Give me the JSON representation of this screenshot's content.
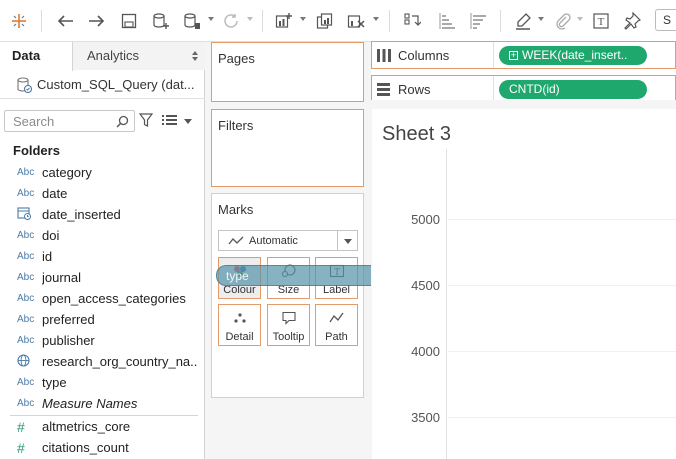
{
  "toolbar": {
    "buttons": [
      "tableau-logo-icon",
      "undo-icon",
      "redo-icon",
      "save-icon",
      "new-datasource-icon",
      "pause-updates-icon",
      "refresh-icon",
      "new-worksheet-icon",
      "duplicate-sheet-icon",
      "clear-sheet-icon",
      "swap-icon",
      "sort-ascending-icon",
      "sort-descending-icon",
      "highlight-icon",
      "group-icon",
      "label-icon",
      "pin-icon"
    ],
    "right_box_label": "S"
  },
  "left_pane": {
    "tabs": [
      {
        "label": "Data"
      },
      {
        "label": "Analytics"
      }
    ],
    "datasource": "Custom_SQL_Query (dat...",
    "search_placeholder": "Search",
    "folders_heading": "Folders",
    "dimensions": [
      {
        "type": "Abc",
        "name": "category"
      },
      {
        "type": "Abc",
        "name": "date"
      },
      {
        "type": "calendar",
        "name": "date_inserted"
      },
      {
        "type": "Abc",
        "name": "doi"
      },
      {
        "type": "Abc",
        "name": "id"
      },
      {
        "type": "Abc",
        "name": "journal"
      },
      {
        "type": "Abc",
        "name": "open_access_categories"
      },
      {
        "type": "Abc",
        "name": "preferred"
      },
      {
        "type": "Abc",
        "name": "publisher"
      },
      {
        "type": "globe",
        "name": "research_org_country_na..."
      },
      {
        "type": "Abc",
        "name": "type"
      },
      {
        "type": "Abc",
        "name": "Measure Names"
      }
    ],
    "measures": [
      {
        "type": "#",
        "name": "altmetrics_core"
      },
      {
        "type": "#",
        "name": "citations_count"
      }
    ]
  },
  "cards": {
    "pages_title": "Pages",
    "filters_title": "Filters",
    "marks_title": "Marks",
    "mark_type": "Automatic",
    "mark_buttons": [
      {
        "label": "Colour"
      },
      {
        "label": "Size"
      },
      {
        "label": "Label"
      },
      {
        "label": "Detail"
      },
      {
        "label": "Tooltip"
      },
      {
        "label": "Path"
      }
    ]
  },
  "drag_pill": {
    "label": "type"
  },
  "shelves": {
    "columns_label": "Columns",
    "columns_pill": "WEEK(date_insert..",
    "rows_label": "Rows",
    "rows_pill": "CNTD(id)"
  },
  "view": {
    "sheet_title": "Sheet 3",
    "y_ticks": [
      "5000",
      "4500",
      "4000",
      "3500"
    ]
  },
  "colors": {
    "accent_orange": "#e39b6a",
    "pill_green": "#1fa86e",
    "drag_pill": "#5292a8",
    "dimension_blue": "#4b7ba6",
    "measure_green": "#2a9a74"
  }
}
